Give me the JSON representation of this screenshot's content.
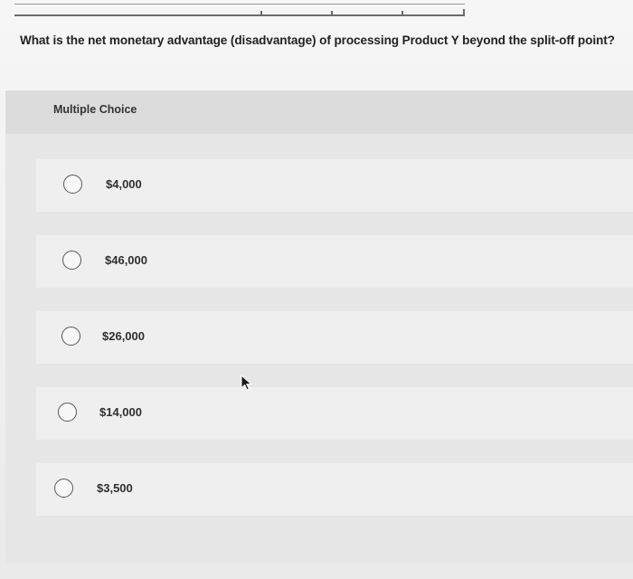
{
  "question": {
    "text": "What is the net monetary advantage (disadvantage) of processing Product Y beyond the split-off point?"
  },
  "choices_panel": {
    "header": "Multiple Choice",
    "options": [
      {
        "label": "$4,000",
        "selected": false
      },
      {
        "label": "$46,000",
        "selected": false
      },
      {
        "label": "$26,000",
        "selected": false
      },
      {
        "label": "$14,000",
        "selected": false
      },
      {
        "label": "$3,500",
        "selected": false
      }
    ]
  },
  "icons": {
    "cursor": "mouse-pointer-icon",
    "radio": "radio-unchecked-icon"
  },
  "colors": {
    "background": "#f1f1f1",
    "panel": "#e6e6e6",
    "option_row": "#efefef",
    "text": "#2b2b2b"
  }
}
